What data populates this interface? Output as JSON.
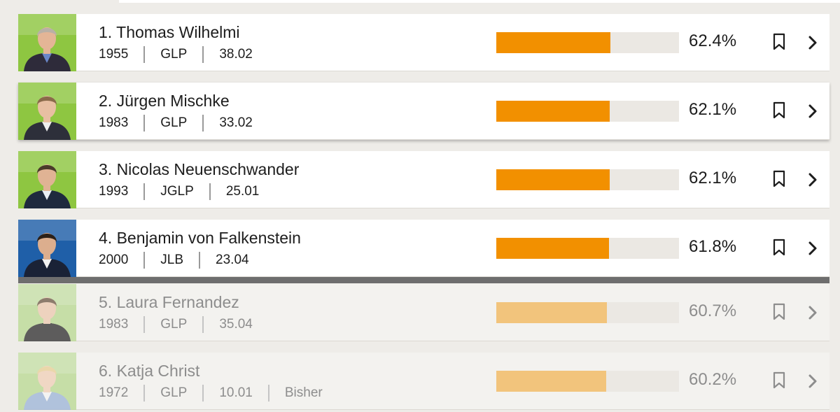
{
  "candidates": [
    {
      "rank_name": "1. Thomas Wilhelmi",
      "year": "1955",
      "party": "GLP",
      "list_no": "38.02",
      "extra": "",
      "percent_label": "62.4%",
      "percent": 62.4,
      "photo": "portrait-older-man-suit",
      "bg": "#8ec641",
      "skin": "#e4b596",
      "hair": "#b9b0a6",
      "suit": "#2e2b3a",
      "shirt": "#6a86c8",
      "dim": false
    },
    {
      "rank_name": "2. Jürgen Mischke",
      "year": "1983",
      "party": "GLP",
      "list_no": "33.02",
      "extra": "",
      "percent_label": "62.1%",
      "percent": 62.1,
      "photo": "portrait-man-glasses",
      "bg": "#8ec641",
      "skin": "#e8bfa2",
      "hair": "#8a6a4a",
      "suit": "#2d2f3a",
      "shirt": "#eeeeee",
      "dim": false
    },
    {
      "rank_name": "3. Nicolas Neuenschwander",
      "year": "1993",
      "party": "JGLP",
      "list_no": "25.01",
      "extra": "",
      "percent_label": "62.1%",
      "percent": 62.1,
      "photo": "portrait-young-man-suit",
      "bg": "#8ec641",
      "skin": "#e0b394",
      "hair": "#4a3a2a",
      "suit": "#1f2a3e",
      "shirt": "#e9eef5",
      "dim": false
    },
    {
      "rank_name": "4. Benjamin von Falkenstein",
      "year": "2000",
      "party": "JLB",
      "list_no": "23.04",
      "extra": "",
      "percent_label": "61.8%",
      "percent": 61.8,
      "photo": "portrait-young-man-blue-backdrop",
      "bg": "#1f5fa8",
      "skin": "#dcae8e",
      "hair": "#2c2018",
      "suit": "#1a2236",
      "shirt": "#f2f2f2",
      "dim": false
    },
    {
      "rank_name": "5. Laura Fernandez",
      "year": "1983",
      "party": "GLP",
      "list_no": "35.04",
      "extra": "",
      "percent_label": "60.7%",
      "percent": 60.7,
      "photo": "portrait-woman-dark-jacket",
      "bg": "#b7d88f",
      "skin": "#ecc8ae",
      "hair": "#6b5542",
      "suit": "#2b2b2b",
      "shirt": "#2b2b2b",
      "dim": true
    },
    {
      "rank_name": "6. Katja Christ",
      "year": "1972",
      "party": "GLP",
      "list_no": "10.01",
      "extra": "Bisher",
      "percent_label": "60.2%",
      "percent": 60.2,
      "photo": "portrait-woman-blonde",
      "bg": "#b7d88f",
      "skin": "#f0cfb6",
      "hair": "#e7cf93",
      "suit": "#9ab3d6",
      "shirt": "#f4f4f4",
      "dim": true
    }
  ],
  "colors": {
    "bar_fill": "#f29000",
    "bar_fill_dim": "#f2c47c",
    "bar_track": "#ebe8e3",
    "cutline": "#6e6e6e"
  },
  "icons": {
    "bookmark": "bookmark-icon",
    "chevron": "chevron-right-icon"
  }
}
